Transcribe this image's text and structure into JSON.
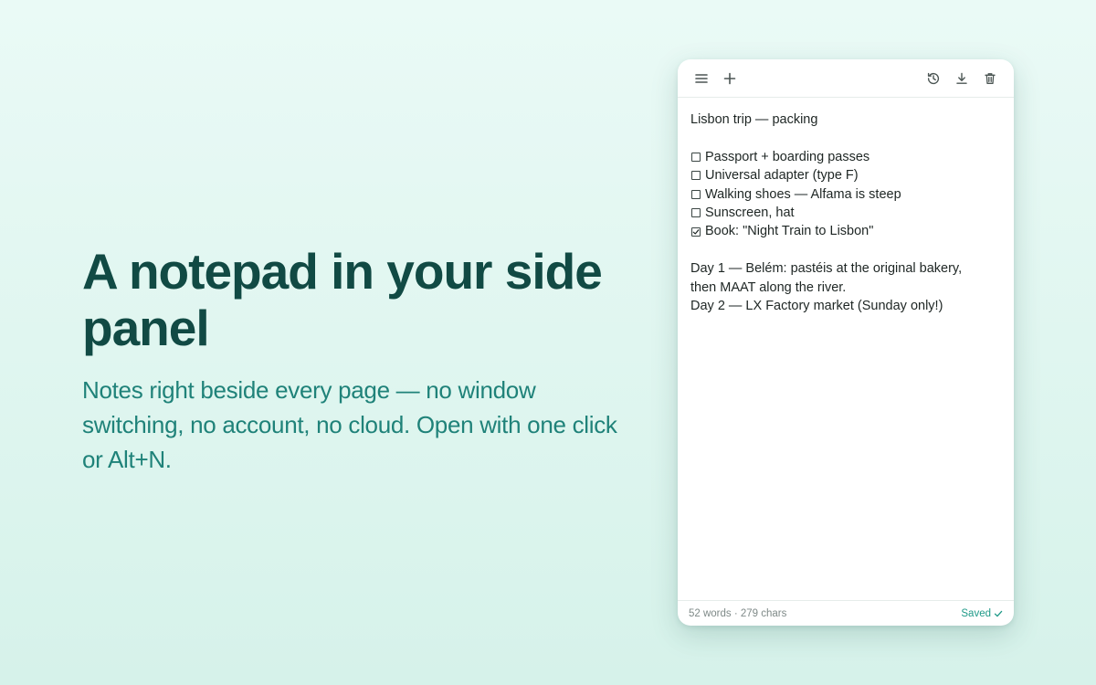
{
  "hero": {
    "title": "A notepad in your side panel",
    "subtitle": "Notes right beside every page — no window switching, no account, no cloud. Open with one click or Alt+N."
  },
  "toolbar": {
    "left_icons": [
      "menu-icon",
      "plus-icon"
    ],
    "right_icons": [
      "history-icon",
      "download-icon",
      "trash-icon"
    ]
  },
  "note": {
    "title_line": "Lisbon trip — packing",
    "checklist": [
      {
        "text": "Passport + boarding passes",
        "checked": false
      },
      {
        "text": "Universal adapter (type F)",
        "checked": false
      },
      {
        "text": "Walking shoes — Alfama is steep",
        "checked": false
      },
      {
        "text": "Sunscreen, hat",
        "checked": false
      },
      {
        "text": "Book: \"Night Train to Lisbon\"",
        "checked": true
      }
    ],
    "itinerary": [
      "Day 1 — Belém: pastéis at the original bakery,",
      "then MAAT along the river.",
      "Day 2 — LX Factory market (Sunday only!)"
    ]
  },
  "footer": {
    "stats": "52 words · 279 chars",
    "status": "Saved"
  },
  "colors": {
    "accent": "#1f9a88",
    "heading": "#114a44",
    "subheading": "#1f8279"
  }
}
